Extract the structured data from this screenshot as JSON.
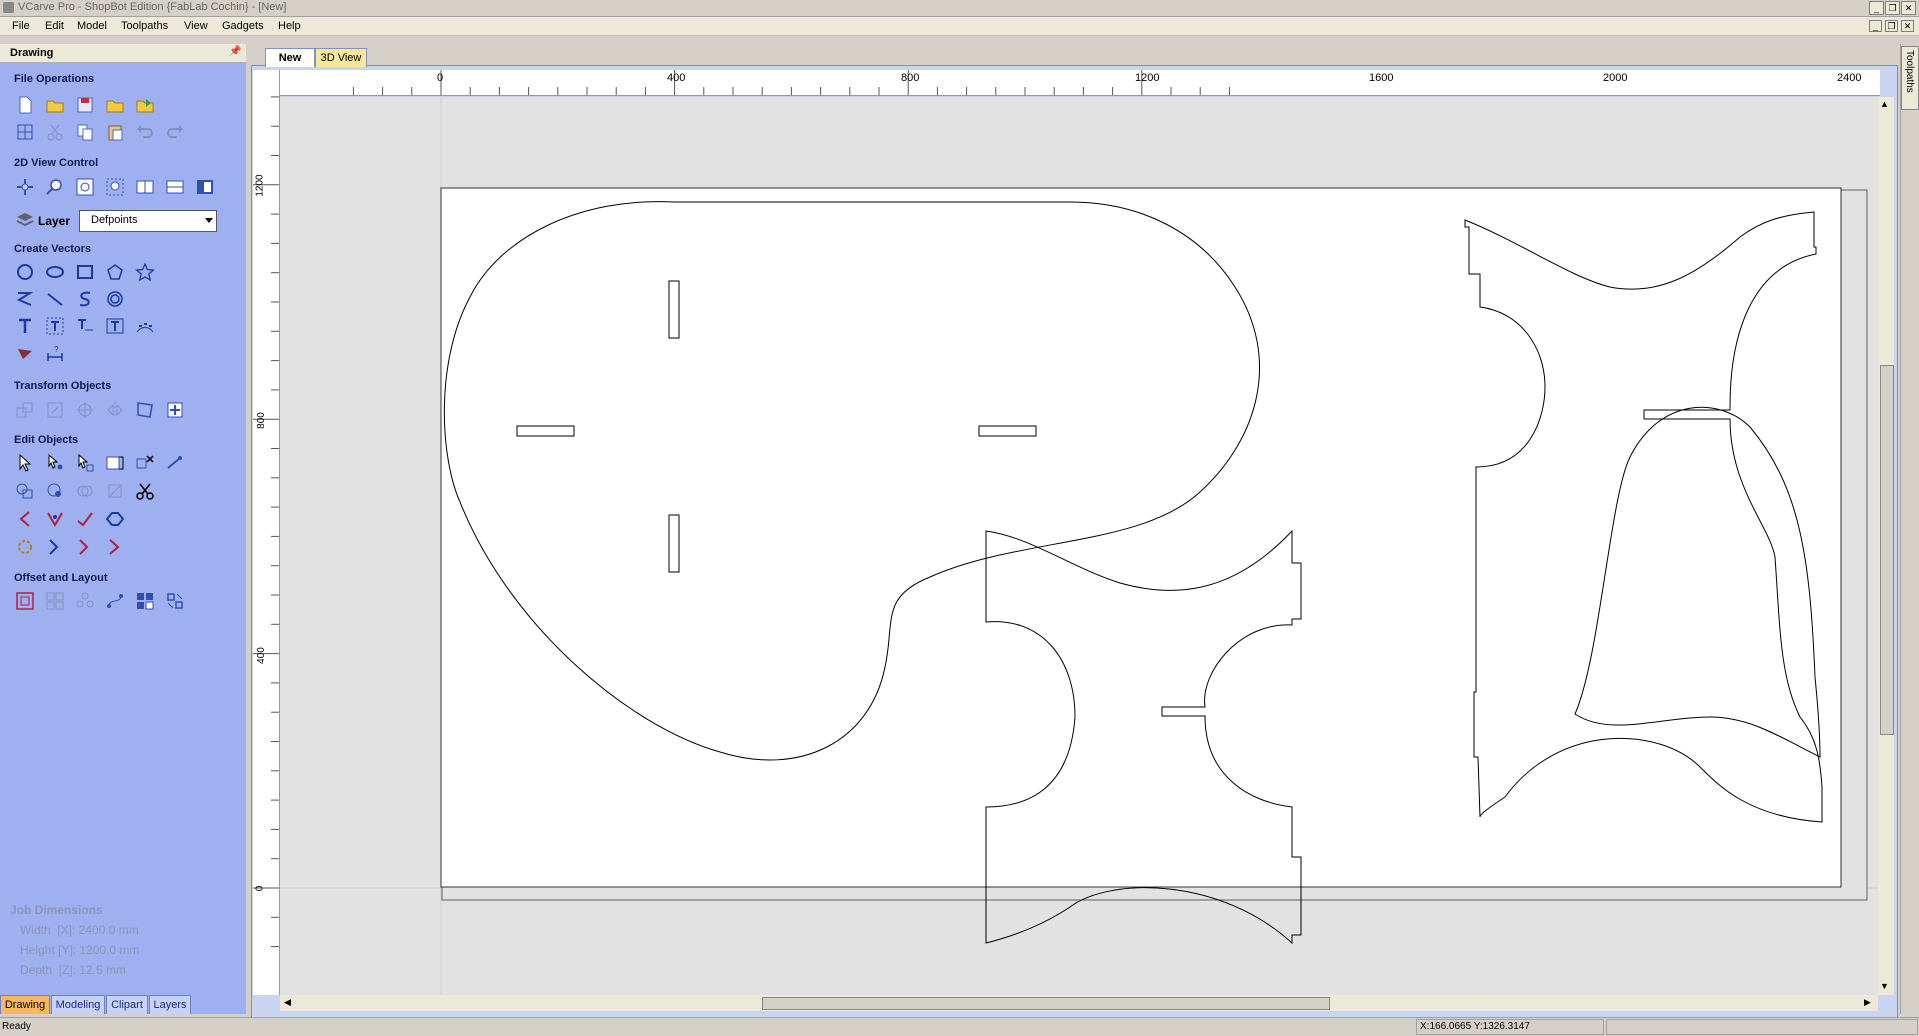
{
  "window": {
    "title": "VCarve Pro - ShopBot Edition {FabLab Cochin} - [New]",
    "controls": [
      "_",
      "❐",
      "✕"
    ]
  },
  "menu": [
    "File",
    "Edit",
    "Model",
    "Toolpaths",
    "View",
    "Gadgets",
    "Help"
  ],
  "panel": {
    "title": "Drawing",
    "sections": {
      "file_operations": "File Operations",
      "view_control": "2D View Control",
      "create_vectors": "Create Vectors",
      "transform_objects": "Transform Objects",
      "edit_objects": "Edit Objects",
      "offset_layout": "Offset and Layout"
    },
    "layer": {
      "label": "Layer",
      "value": "Defpoints"
    },
    "job": {
      "title": "Job Dimensions",
      "width": "Width  [X]: 2400.0 mm",
      "height": "Height [Y]: 1200.0 mm",
      "depth": "Depth  [Z]: 12.5 mm"
    },
    "tabs": [
      "Drawing",
      "Modeling",
      "Clipart",
      "Layers"
    ]
  },
  "doc_tabs": [
    "New",
    "3D View"
  ],
  "ruler": {
    "x_labels": [
      "0",
      "400",
      "800",
      "1200",
      "1600",
      "2000",
      "2400"
    ],
    "y_labels": [
      "1200",
      "800",
      "400",
      "0"
    ]
  },
  "right_tab": "Toolpaths",
  "status": {
    "left": "Ready",
    "coords": "X:166.0665 Y:1326.3147"
  },
  "colors": {
    "panel_bg": "#9fb0f0",
    "active_tab": "#f4b860",
    "doc_tab_active": "#ffffff",
    "doc_tab_inactive": "#f6e79a"
  }
}
